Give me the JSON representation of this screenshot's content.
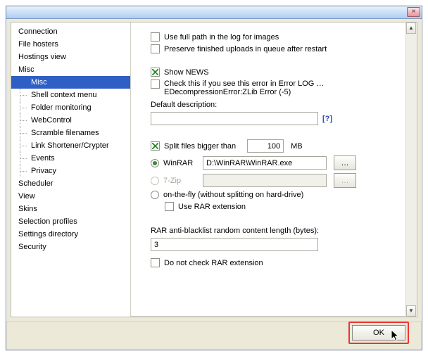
{
  "titlebar": {
    "close": "×"
  },
  "tree": {
    "items": [
      {
        "label": "Connection"
      },
      {
        "label": "File hosters"
      },
      {
        "label": "Hostings view"
      },
      {
        "label": "Misc"
      }
    ],
    "misc_children": [
      {
        "label": "Misc",
        "selected": true
      },
      {
        "label": "Shell context menu"
      },
      {
        "label": "Folder monitoring"
      },
      {
        "label": "WebControl"
      },
      {
        "label": "Scramble filenames"
      },
      {
        "label": "Link Shortener/Crypter"
      },
      {
        "label": "Events"
      },
      {
        "label": "Privacy"
      }
    ],
    "after": [
      {
        "label": "Scheduler"
      },
      {
        "label": "View"
      },
      {
        "label": "Skins"
      },
      {
        "label": "Selection profiles"
      },
      {
        "label": "Settings directory"
      },
      {
        "label": "Security"
      }
    ]
  },
  "panel": {
    "use_full_path": {
      "checked": false,
      "label": "Use full path in the log for images"
    },
    "preserve_queue": {
      "checked": false,
      "label": "Preserve finished uploads in queue after restart"
    },
    "show_news": {
      "checked": true,
      "label": "Show NEWS"
    },
    "zlib_error": {
      "checked": false,
      "label": "Check this if you see this error in Error LOG …",
      "sub": "EDecompressionError:ZLib Error (-5)"
    },
    "default_desc": {
      "label": "Default description:",
      "value": "",
      "help": "[?]"
    },
    "split": {
      "checked": true,
      "label": "Split files bigger than",
      "value": "100",
      "unit": "MB"
    },
    "archiver": {
      "winrar": {
        "selected": true,
        "label": "WinRAR",
        "path": "D:\\WinRAR\\WinRAR.exe",
        "browse": "…"
      },
      "sevenzip": {
        "selected": false,
        "disabled": true,
        "label": "7-Zip",
        "path": "",
        "browse": "…"
      },
      "onthefly": {
        "selected": false,
        "label": "on-the-fly (without splitting on hard-drive)"
      },
      "use_rar_ext": {
        "checked": false,
        "label": "Use RAR extension"
      }
    },
    "anti_blacklist": {
      "label": "RAR anti-blacklist random content length (bytes):",
      "value": "3"
    },
    "no_check_rar": {
      "checked": false,
      "label": "Do not check RAR extension"
    }
  },
  "footer": {
    "ok": "OK"
  }
}
